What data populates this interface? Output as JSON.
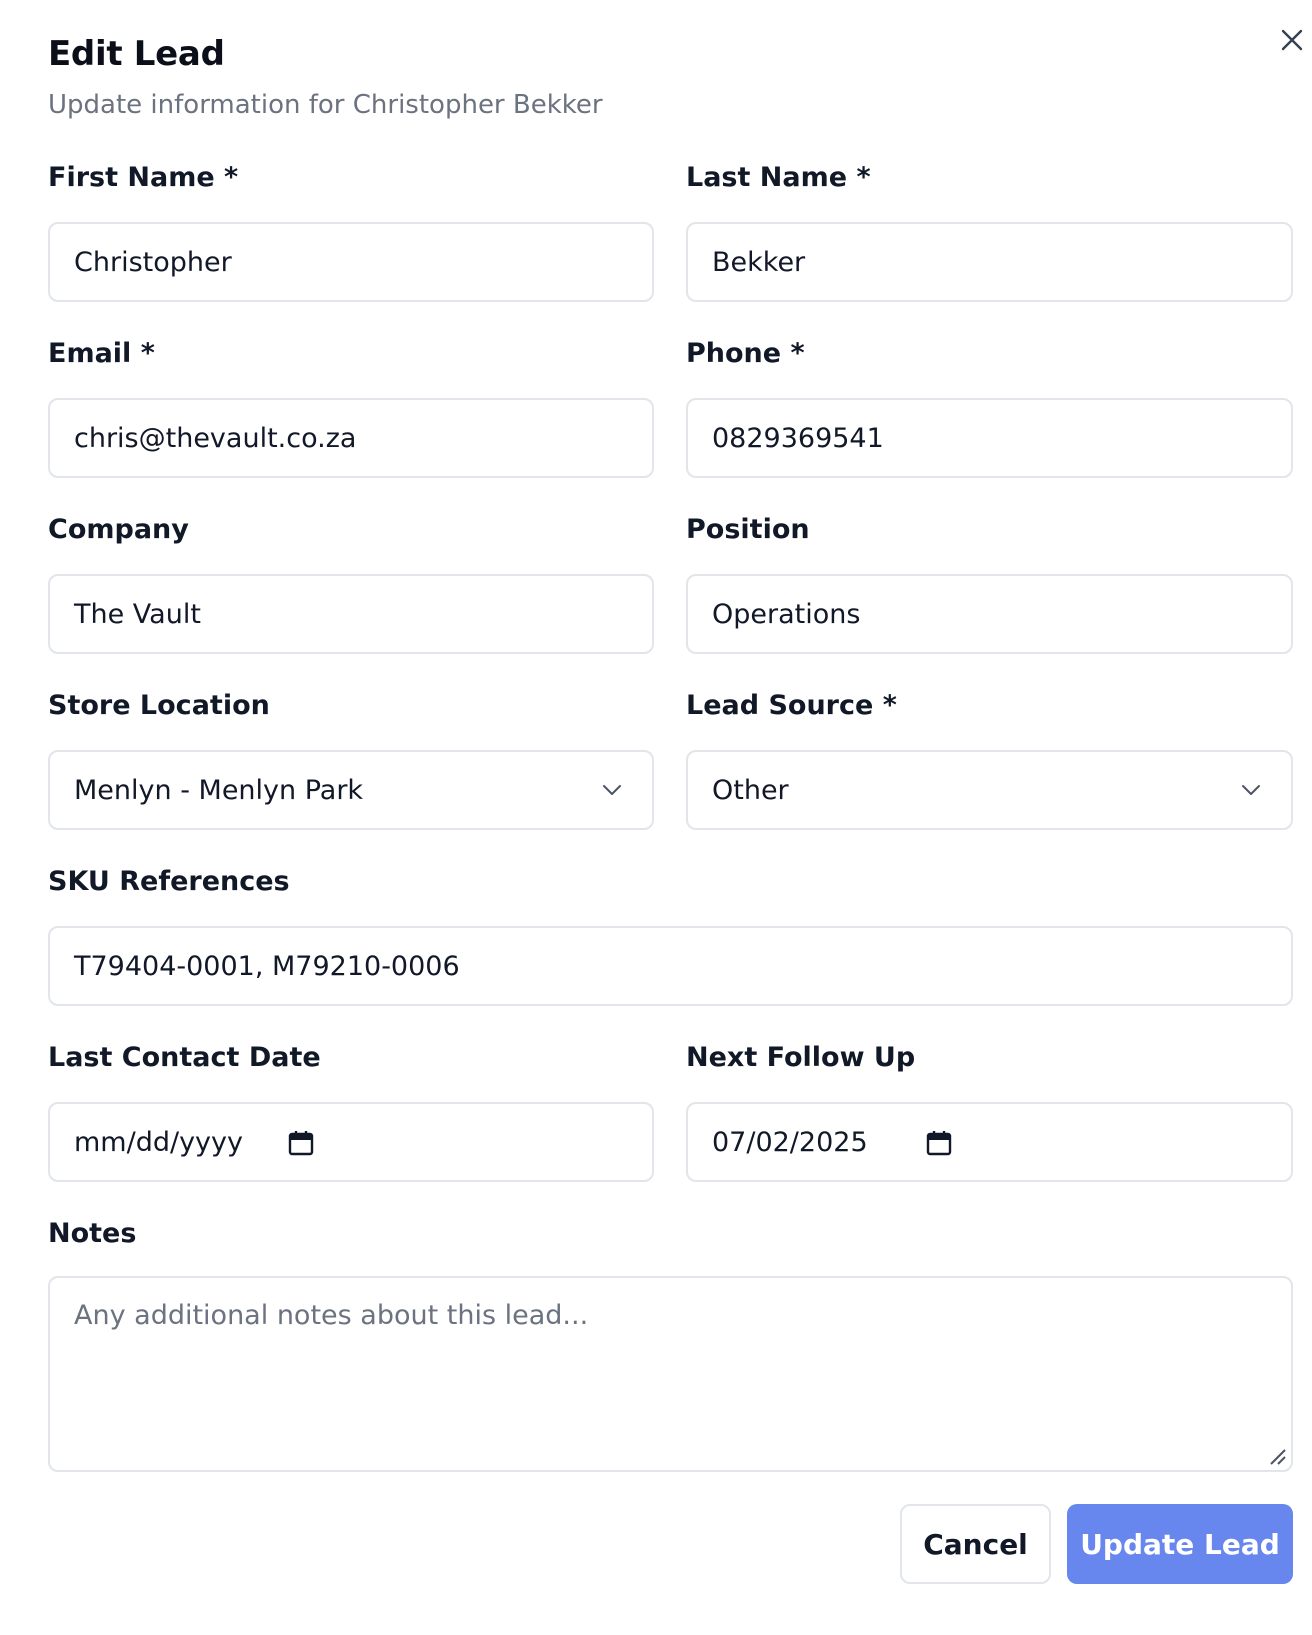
{
  "dialog": {
    "title": "Edit Lead",
    "subtitle": "Update information for Christopher Bekker",
    "close_icon": "close-icon"
  },
  "fields": {
    "first_name": {
      "label": "First Name *",
      "value": "Christopher"
    },
    "last_name": {
      "label": "Last Name *",
      "value": "Bekker"
    },
    "email": {
      "label": "Email *",
      "value": "chris@thevault.co.za"
    },
    "phone": {
      "label": "Phone *",
      "value": "0829369541"
    },
    "company": {
      "label": "Company",
      "value": "The Vault"
    },
    "position": {
      "label": "Position",
      "value": "Operations"
    },
    "store_location": {
      "label": "Store Location",
      "value": "Menlyn - Menlyn Park"
    },
    "lead_source": {
      "label": "Lead Source *",
      "value": "Other"
    },
    "sku_references": {
      "label": "SKU References",
      "value": "T79404-0001, M79210-0006"
    },
    "last_contact_date": {
      "label": "Last Contact Date",
      "value": "mm/dd/yyyy"
    },
    "next_follow_up": {
      "label": "Next Follow Up",
      "value": "07/02/2025"
    },
    "notes": {
      "label": "Notes",
      "placeholder": "Any additional notes about this lead..."
    }
  },
  "actions": {
    "cancel_label": "Cancel",
    "submit_label": "Update Lead"
  },
  "colors": {
    "primary": "#6787ee",
    "border": "#e2e5ea",
    "muted_text": "#6b7280"
  }
}
